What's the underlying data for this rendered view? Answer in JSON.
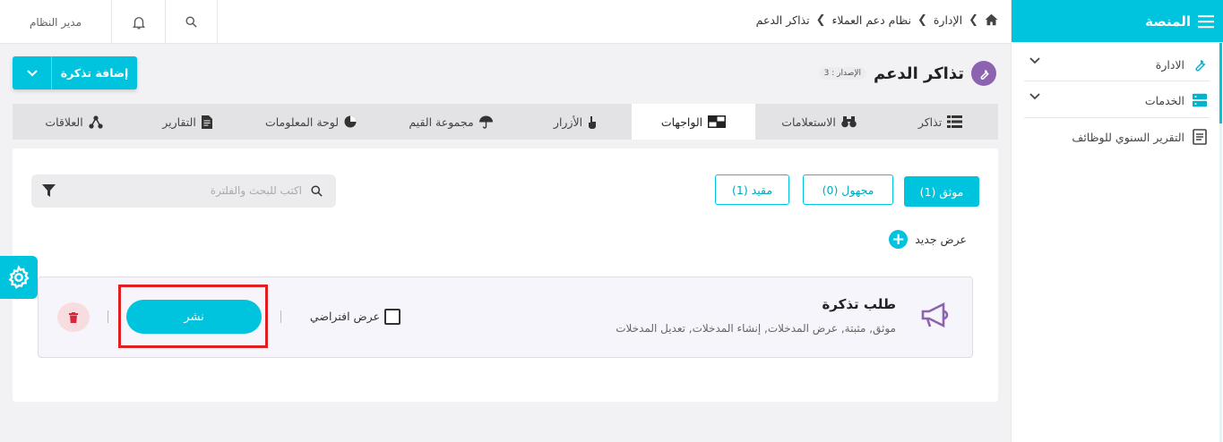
{
  "topbar": {
    "user_label": "مدير النظام",
    "breadcrumbs": [
      "الإدارة",
      "نظام دعم العملاء",
      "تذاكر الدعم"
    ]
  },
  "sidebar": {
    "title": "المنصة",
    "items": [
      {
        "label": "الادارة",
        "icon": "wrench-icon",
        "expandable": true
      },
      {
        "label": "الخدمات",
        "icon": "server-icon",
        "expandable": true
      },
      {
        "label": "التقرير السنوي للوظائف",
        "icon": "report-icon",
        "expandable": false
      }
    ]
  },
  "page": {
    "title": "تذاكر الدعم",
    "version_badge": "الإصدار : 3",
    "add_button": "إضافة تذكرة"
  },
  "tabs": [
    {
      "label": "تذاكر",
      "icon": "list-icon",
      "active": false
    },
    {
      "label": "الاستعلامات",
      "icon": "binoculars-icon",
      "active": false
    },
    {
      "label": "الواجهات",
      "icon": "layout-icon",
      "active": true
    },
    {
      "label": "الأزرار",
      "icon": "pointer-icon",
      "active": false
    },
    {
      "label": "مجموعة القيم",
      "icon": "umbrella-icon",
      "active": false
    },
    {
      "label": "لوحة المعلومات",
      "icon": "pie-icon",
      "active": false
    },
    {
      "label": "التقارير",
      "icon": "document-icon",
      "active": false
    },
    {
      "label": "العلاقات",
      "icon": "relations-icon",
      "active": false
    }
  ],
  "filters": [
    {
      "label": "موثق (1)",
      "active": true
    },
    {
      "label": "مجهول (0)",
      "active": false
    },
    {
      "label": "مقيد (1)",
      "active": false
    }
  ],
  "search": {
    "placeholder": "اكتب للبحث والفلترة"
  },
  "new_view": "عرض جديد",
  "card": {
    "title": "طلب تذكرة",
    "subtitle": "موثق, مثبتة, عرض المدخلات, إنشاء المدخلات, تعديل المدخلات",
    "default_label": "عرض افتراضي",
    "default_checked": false,
    "publish_label": "نشر"
  },
  "colors": {
    "accent": "#00c4dd",
    "purple": "#8c63b1",
    "highlight": "#e02020",
    "delete": "#d9263c"
  }
}
